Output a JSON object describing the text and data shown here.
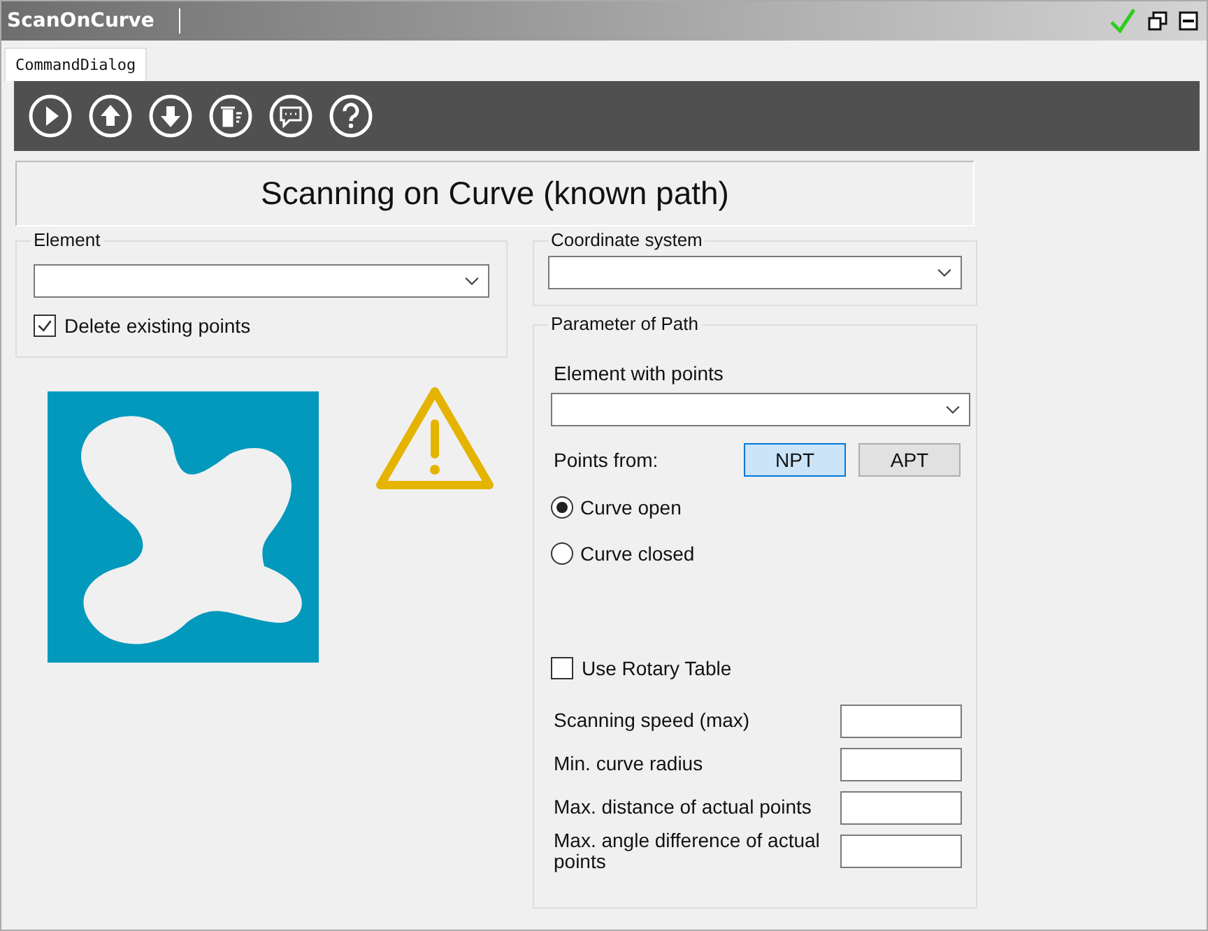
{
  "window": {
    "title": "ScanOnCurve"
  },
  "title_actions": [
    {
      "kind": "ok"
    },
    {
      "kind": "restore"
    },
    {
      "kind": "minimize"
    }
  ],
  "tabs": [
    {
      "label": "CommandDialog",
      "selected": true
    }
  ],
  "toolbar": [
    {
      "kind": "play"
    },
    {
      "kind": "up"
    },
    {
      "kind": "down"
    },
    {
      "kind": "delete"
    },
    {
      "kind": "comment"
    },
    {
      "kind": "help"
    }
  ],
  "heading": "Scanning on Curve (known path)",
  "element_group": {
    "label": "Element",
    "checkbox": {
      "label": "Delete existing points",
      "checked": true
    }
  },
  "coordinate_group": {
    "label": "Coordinate system"
  },
  "path_group": {
    "label": "Parameter of Path",
    "element_label": "Element with points",
    "points_from": {
      "label": "Points from:",
      "options": [
        {
          "label": "NPT",
          "selected": true
        },
        {
          "label": "APT",
          "selected": false
        }
      ]
    },
    "radios": [
      {
        "label": "Curve open",
        "selected": true
      },
      {
        "label": "Curve closed",
        "selected": false
      }
    ],
    "rotary": {
      "label": "Use Rotary Table",
      "checked": false
    },
    "fields": [
      {
        "label": "Scanning speed (max)"
      },
      {
        "label": "Min. curve radius"
      },
      {
        "label": "Max. distance of actual points"
      },
      {
        "label": "Max. angle difference of actual points"
      }
    ]
  }
}
